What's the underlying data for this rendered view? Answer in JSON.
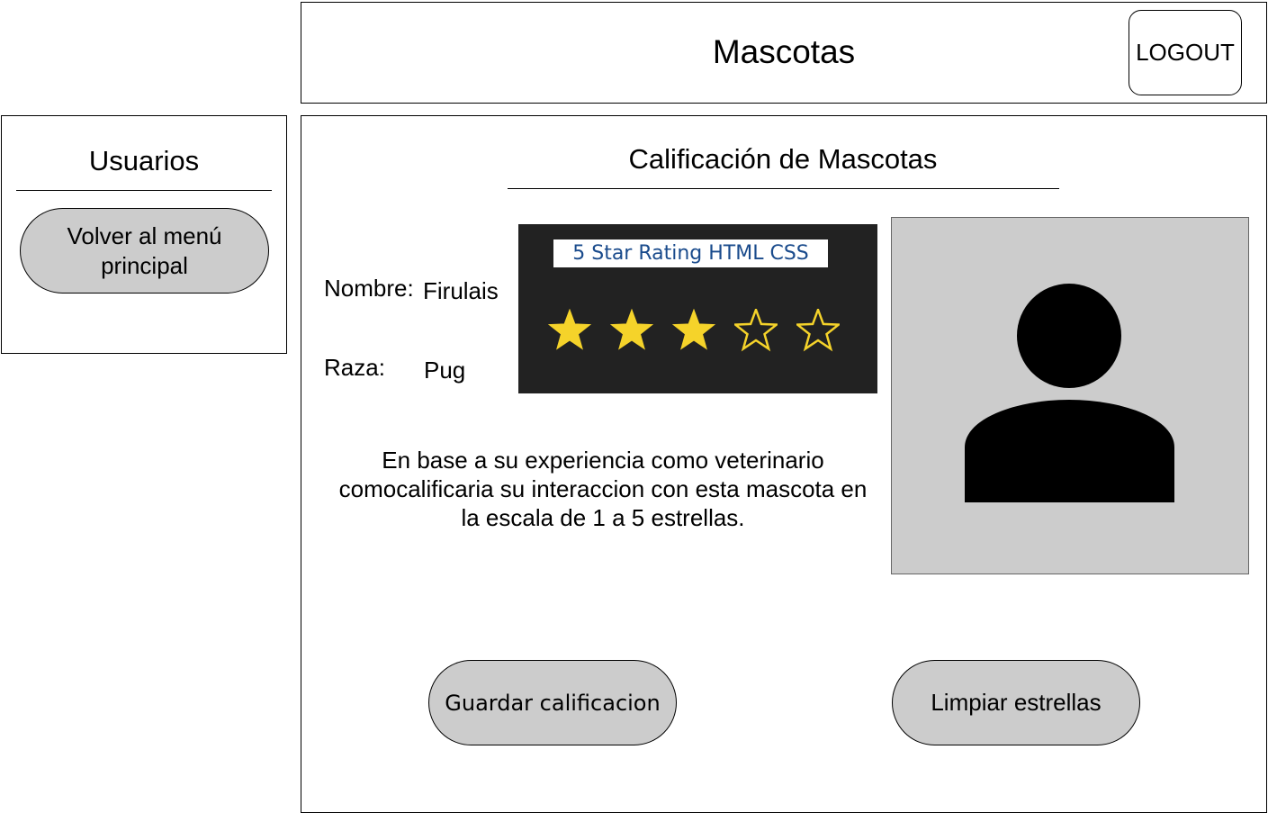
{
  "header": {
    "title": "Mascotas",
    "logout_label": "LOGOUT"
  },
  "sidebar": {
    "title": "Usuarios",
    "back_label": "Volver al menú principal"
  },
  "main": {
    "title": "Calificación de Mascotas",
    "name_label": "Nombre:",
    "name_value": "Firulais",
    "breed_label": "Raza:",
    "breed_value": "Pug",
    "rating": {
      "banner": "5 Star Rating HTML CSS",
      "filled": 3,
      "max": 5,
      "filled_color": "#f5d32a",
      "empty_color": "#f5d32a",
      "background_color": "#222222"
    },
    "description": "En base a su experiencia como veterinario comocalificaria su interaccion con esta mascota en la escala de 1 a 5 estrellas.",
    "photo_icon": "person-icon",
    "save_label": "Guardar calificacion",
    "clear_label": "Limpiar estrellas"
  }
}
